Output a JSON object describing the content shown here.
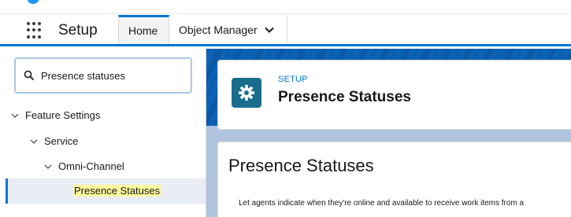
{
  "colors": {
    "brand_blue": "#0176d3",
    "banner_blue": "#0b5cab",
    "setup_icon_teal": "#196c8c",
    "selected_highlight": "#fdf99e"
  },
  "nav": {
    "app_launcher_icon": "app-launcher-grid-icon",
    "app_name": "Setup",
    "tabs": [
      {
        "label": "Home",
        "active": true
      },
      {
        "label": "Object Manager",
        "active": false,
        "icon": "chevron-down-icon"
      }
    ]
  },
  "sidebar": {
    "search": {
      "icon": "search-icon",
      "value": "Presence statuses"
    },
    "tree": [
      {
        "label": "Feature Settings",
        "icon": "chevron-down-icon",
        "level": 1
      },
      {
        "label": "Service",
        "icon": "chevron-down-icon",
        "level": 2
      },
      {
        "label": "Omni-Channel",
        "icon": "chevron-down-icon",
        "level": 3
      },
      {
        "label": "Presence Statuses",
        "level": 4,
        "selected": true
      }
    ]
  },
  "header": {
    "icon": "gear-icon",
    "eyebrow": "SETUP",
    "title": "Presence Statuses"
  },
  "content": {
    "title": "Presence Statuses",
    "description": "Let agents indicate when they're online and available to receive work items from a"
  }
}
